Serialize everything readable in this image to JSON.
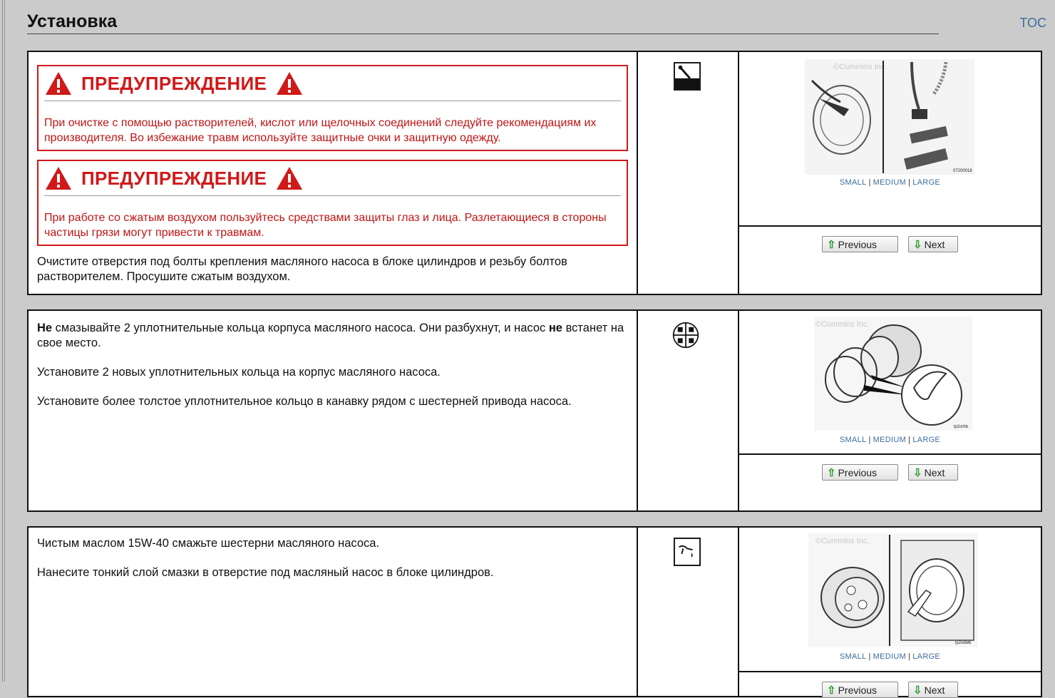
{
  "header": {
    "title": "Установка",
    "toc_label": "TOC"
  },
  "size_links": {
    "small": "SMALL",
    "medium": "MEDIUM",
    "large": "LARGE",
    "separator": "|"
  },
  "buttons": {
    "previous": "Previous",
    "next": "Next"
  },
  "watermark": "©Cummins Inc.",
  "steps": [
    {
      "warnings": [
        {
          "title": "ПРЕДУПРЕЖДЕНИЕ",
          "text": "При очистке с помощью растворителей, кислот или щелочных соединений следуйте рекомендациям их производителя. Во избежание травм используйте защитные очки и защитную одежду."
        },
        {
          "title": "ПРЕДУПРЕЖДЕНИЕ",
          "text": "При работе со сжатым воздухом пользуйтесь средствами защиты глаз и лица. Разлетающиеся в стороны частицы грязи могут привести к травмам."
        }
      ],
      "text": "Очистите отверстия под болты крепления масляного насоса в блоке цилиндров и резьбу болтов растворителем. Просушите сжатым воздухом.",
      "icon": "cleaning-solvent-icon",
      "image_code": "07200018"
    },
    {
      "p1_bold_start": "Не",
      "p1_mid": " смазывайте 2 уплотнительные кольца корпуса масляного насоса. Они разбухнут, и насос ",
      "p1_bold_end": "не",
      "p1_end": " встанет на свое место.",
      "p2": "Установите 2 новых уплотнительных кольца на корпус масляного насоса.",
      "p3": "Установите более толстое уплотнительное кольцо в канавку рядом с шестерней привода насоса.",
      "icon": "assembly-parts-icon",
      "image_code": "lp2orhb"
    },
    {
      "p1": "Чистым маслом 15W-40 смажьте шестерни масляного насоса.",
      "p2": "Нанесите тонкий слой смазки в отверстие под масляный насос в блоке цилиндров.",
      "icon": "lubricate-icon",
      "image_code": "lp2odwb"
    }
  ]
}
